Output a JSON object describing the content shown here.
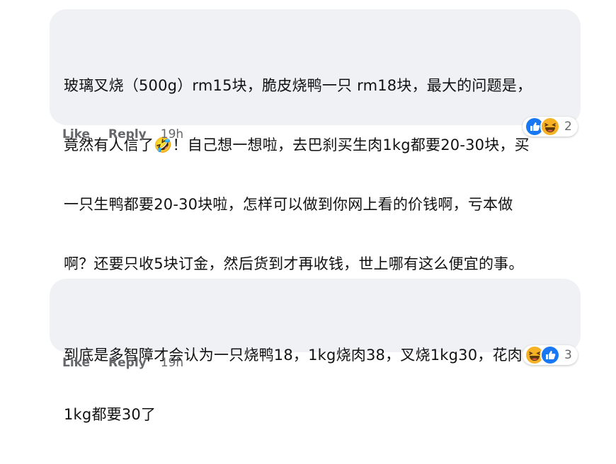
{
  "comments": [
    {
      "lines": [
        "玻璃叉烧（500g）rm15块，脆皮烧鸭一只 rm18块，最大的问题是，",
        "竟然有人信了🤣！自己想一想啦，去巴刹买生肉1kg都要20-30块，买",
        "一只生鸭都要20-30块啦，怎样可以做到你网上看的价钱啊，亏本做",
        "啊？还要只收5块订金，然后货到才再收钱，世上哪有这么便宜的事。"
      ],
      "reactions": [
        "like-icon",
        "haha-icon"
      ],
      "reaction_count": "2",
      "actions": {
        "like": "Like",
        "reply": "Reply",
        "time": "19h"
      }
    },
    {
      "lines": [
        "到底是多智障才会认为一只烧鸭18，1kg烧肉38，叉烧1kg30，花肉",
        "1kg都要30了"
      ],
      "reactions": [
        "haha-icon",
        "like-icon"
      ],
      "reaction_count": "3",
      "actions": {
        "like": "Like",
        "reply": "Reply",
        "time": "19h"
      }
    }
  ],
  "colors": {
    "bubble_bg": "#eff1f4",
    "text": "#111111",
    "action_text": "#65676b",
    "like_blue": "#1877f2",
    "haha_yellow": "#f7b125"
  }
}
